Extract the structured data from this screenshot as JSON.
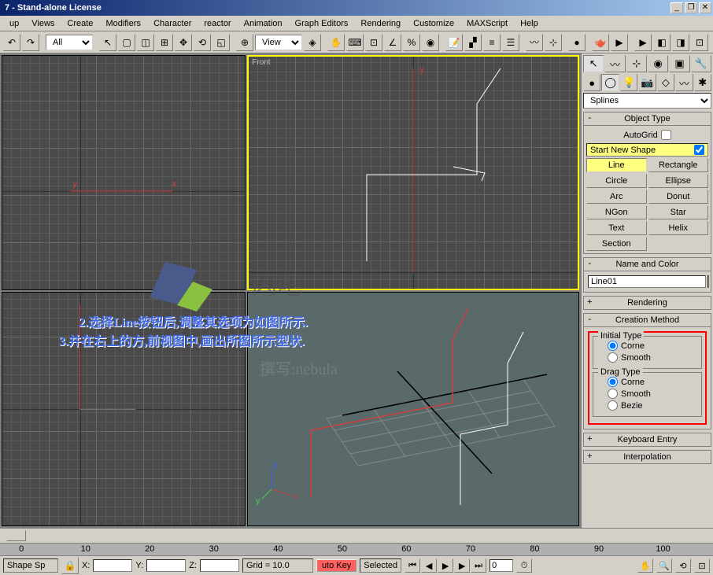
{
  "title": "7 - Stand-alone License",
  "menu": [
    "up",
    "Views",
    "Create",
    "Modifiers",
    "Character",
    "reactor",
    "Animation",
    "Graph Editors",
    "Rendering",
    "Customize",
    "MAXScript",
    "Help"
  ],
  "menu_accel": [
    "u",
    "V",
    "C",
    "M",
    "h",
    "r",
    "A",
    "G",
    "R",
    "u",
    "M",
    "H"
  ],
  "toolbar": {
    "selset": "All",
    "viewsel": "View"
  },
  "viewport_labels": [
    "",
    "Front",
    "",
    ""
  ],
  "axis_labels": {
    "x": "x",
    "y": "y",
    "z": "z"
  },
  "panel": {
    "dropdown": "Splines",
    "object_type_title": "Object Type",
    "autogrid_label": "AutoGrid",
    "startshape_label": "Start New Shape",
    "startshape_checked": true,
    "buttons": [
      "Line",
      "Rectangle",
      "Circle",
      "Ellipse",
      "Arc",
      "Donut",
      "NGon",
      "Star",
      "Text",
      "Helix",
      "Section",
      ""
    ],
    "active_button": "Line",
    "name_color_title": "Name and Color",
    "object_name": "Line01",
    "object_color": "#ff4040",
    "rendering_title": "Rendering",
    "creation_title": "Creation Method",
    "initial_type_label": "Initial Type",
    "drag_type_label": "Drag Type",
    "initial_options": [
      "Corne",
      "Smooth"
    ],
    "initial_selected": "Corne",
    "drag_options": [
      "Corne",
      "Smooth",
      "Bezie"
    ],
    "drag_selected": "Corne",
    "keyboard_title": "Keyboard Entry",
    "interp_title": "Interpolation"
  },
  "timeline": {
    "ticks": [
      0,
      10,
      20,
      30,
      40,
      50,
      60,
      70,
      80,
      90,
      100
    ]
  },
  "status": {
    "prompt": "Shape Sp",
    "x_label": "X:",
    "y_label": "Y:",
    "z_label": "Z:",
    "grid": "Grid = 10.0",
    "autokey": "uto Key",
    "selected": "Selected",
    "frame": "0"
  },
  "annotations": {
    "line1": "2.选择Line按钮后,调整其选项为如图所示.",
    "line2": "3.并在右上的方,前视图中,画出所图所示型状.",
    "watermark": "撰写:nebula",
    "logotext": "闪吧"
  },
  "window_buttons": [
    "_",
    "❐",
    "✕"
  ]
}
